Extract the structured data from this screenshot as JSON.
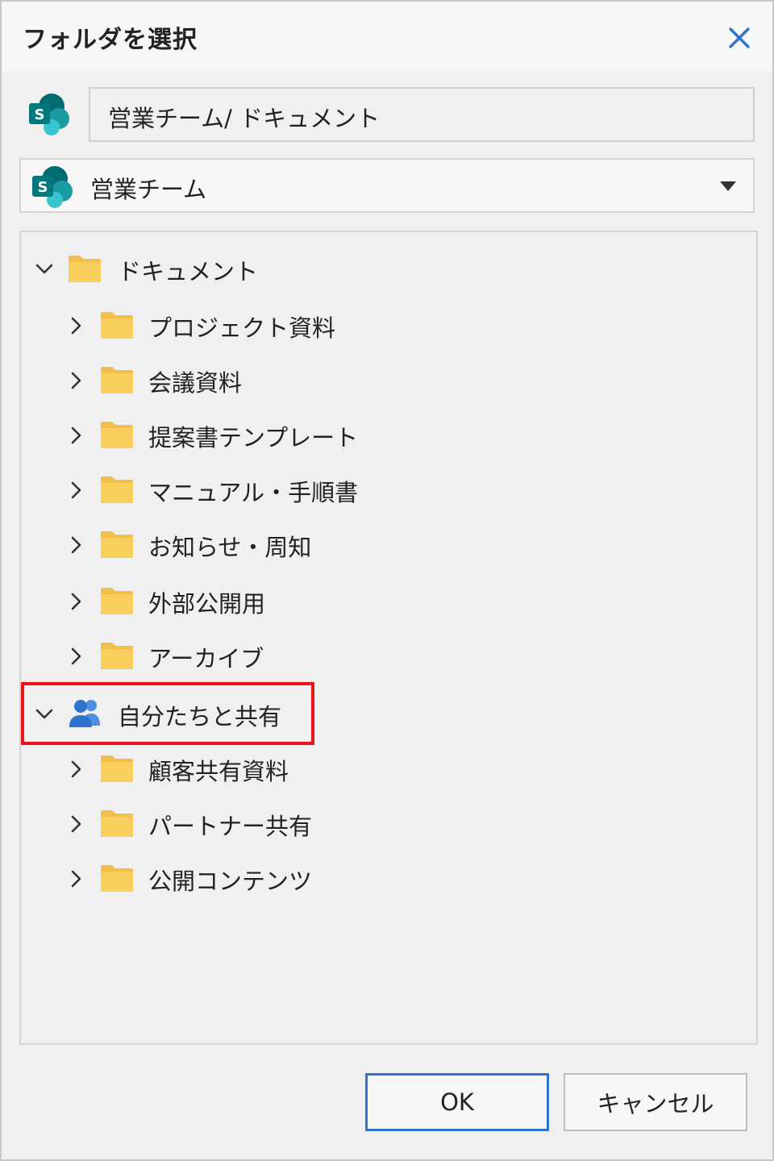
{
  "dialog": {
    "title": "フォルダを選択",
    "close_icon": "close-icon",
    "accent_color": "#2f73d1"
  },
  "path": {
    "icon": "sharepoint-icon",
    "text": "営業チーム/ ドキュメント"
  },
  "site_select": {
    "icon": "sharepoint-icon",
    "value": "営業チーム"
  },
  "tree": {
    "root": {
      "label": "ドキュメント",
      "expanded": true
    },
    "root_children": [
      {
        "label": "プロジェクト資料"
      },
      {
        "label": "会議資料"
      },
      {
        "label": "提案書テンプレート"
      },
      {
        "label": "マニュアル・手順書"
      },
      {
        "label": "お知らせ・周知"
      },
      {
        "label": "外部公開用"
      },
      {
        "label": "アーカイブ"
      }
    ],
    "shared": {
      "label": "自分たちと共有",
      "expanded": true,
      "highlight_color": "#e8151b"
    },
    "shared_children": [
      {
        "label": "顧客共有資料"
      },
      {
        "label": "パートナー共有"
      },
      {
        "label": "公開コンテンツ"
      }
    ],
    "folder_color": "#f8cf5c"
  },
  "buttons": {
    "ok": "OK",
    "cancel": "キャンセル"
  }
}
